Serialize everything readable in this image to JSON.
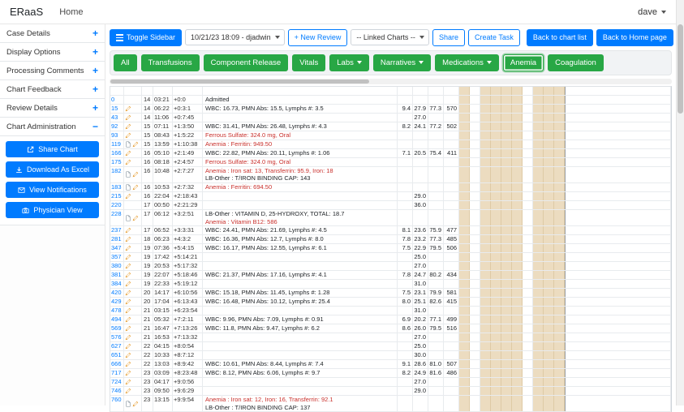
{
  "navbar": {
    "brand": "ERaaS",
    "home": "Home",
    "user": "dave"
  },
  "colors": {
    "primary": "#007bff",
    "success": "#28a745",
    "danger": "#c9302c",
    "highlight_cell": "#ecdcc0"
  },
  "sidebar": {
    "sections": [
      {
        "label": "Case Details",
        "toggle": "+",
        "expanded": false
      },
      {
        "label": "Display Options",
        "toggle": "+",
        "expanded": false
      },
      {
        "label": "Processing Comments",
        "toggle": "+",
        "expanded": false
      },
      {
        "label": "Chart Feedback",
        "toggle": "+",
        "expanded": false
      },
      {
        "label": "Review Details",
        "toggle": "+",
        "expanded": false
      },
      {
        "label": "Chart Administration",
        "toggle": "−",
        "expanded": true
      }
    ],
    "admin_buttons": [
      {
        "label": "Share Chart",
        "icon": "share-icon"
      },
      {
        "label": "Download As Excel",
        "icon": "download-icon"
      },
      {
        "label": "View Notifications",
        "icon": "mail-icon"
      },
      {
        "label": "Physician View",
        "icon": "camera-icon"
      }
    ]
  },
  "toolbar": {
    "toggle_sidebar": "Toggle Sidebar",
    "review_select": "10/21/23 18:09 - djadwin",
    "new_review": "+ New Review",
    "linked_charts": "-- Linked Charts --",
    "share": "Share",
    "create_task": "Create Task",
    "back_to_chart_list": "Back to chart list",
    "back_to_home": "Back to Home page"
  },
  "filters": [
    {
      "label": "All",
      "dropdown": false,
      "active": false
    },
    {
      "label": "Transfusions",
      "dropdown": false,
      "active": false
    },
    {
      "label": "Component Release",
      "dropdown": false,
      "active": false
    },
    {
      "label": "Vitals",
      "dropdown": false,
      "active": false
    },
    {
      "label": "Labs",
      "dropdown": true,
      "active": false
    },
    {
      "label": "Narratives",
      "dropdown": true,
      "active": false
    },
    {
      "label": "Medications",
      "dropdown": true,
      "active": false
    },
    {
      "label": "Anemia",
      "dropdown": false,
      "active": true
    },
    {
      "label": "Coagulation",
      "dropdown": false,
      "active": false
    }
  ],
  "table": {
    "stripes": [
      1,
      0,
      1,
      1,
      1,
      1,
      0,
      1,
      1,
      1
    ],
    "rows": [
      {
        "id": "0",
        "icons": [],
        "day": "14",
        "time": "03:21",
        "off": "+0:0",
        "lines": [
          {
            "t": "Admitted",
            "red": false
          }
        ],
        "vals": [
          "",
          "",
          "",
          ""
        ]
      },
      {
        "id": "15",
        "icons": [
          "pencil"
        ],
        "day": "14",
        "time": "06:22",
        "off": "+0:3:1",
        "lines": [
          {
            "t": "WBC: 16.73, PMN Abs: 15.5, Lymphs #: 3.5",
            "red": false
          }
        ],
        "vals": [
          "9.4",
          "27.9",
          "77.3",
          "570"
        ]
      },
      {
        "id": "43",
        "icons": [
          "pencil"
        ],
        "day": "14",
        "time": "11:06",
        "off": "+0:7:45",
        "lines": [],
        "vals": [
          "",
          "27.0",
          "",
          ""
        ]
      },
      {
        "id": "92",
        "icons": [
          "pencil"
        ],
        "day": "15",
        "time": "07:11",
        "off": "+1:3:50",
        "lines": [
          {
            "t": "WBC: 31.41, PMN Abs: 26.48, Lymphs #: 4.3",
            "red": false
          }
        ],
        "vals": [
          "8.2",
          "24.1",
          "77.2",
          "502"
        ]
      },
      {
        "id": "93",
        "icons": [
          "pencil"
        ],
        "day": "15",
        "time": "08:43",
        "off": "+1:5:22",
        "lines": [
          {
            "t": "Ferrous Sulfate: 324.0 mg, Oral",
            "red": true
          }
        ],
        "vals": [
          "",
          "",
          "",
          ""
        ]
      },
      {
        "id": "119",
        "icons": [
          "doc",
          "pencil"
        ],
        "day": "15",
        "time": "13:59",
        "off": "+1:10:38",
        "lines": [
          {
            "t": "Anemia : Ferritin: 949.50",
            "red": true
          }
        ],
        "vals": [
          "",
          "",
          "",
          ""
        ]
      },
      {
        "id": "166",
        "icons": [
          "pencil"
        ],
        "day": "16",
        "time": "05:10",
        "off": "+2:1:49",
        "lines": [
          {
            "t": "WBC: 22.82, PMN Abs: 20.11, Lymphs #: 1.06",
            "red": false
          }
        ],
        "vals": [
          "7.1",
          "20.5",
          "75.4",
          "411"
        ]
      },
      {
        "id": "175",
        "icons": [
          "pencil"
        ],
        "day": "16",
        "time": "08:18",
        "off": "+2:4:57",
        "lines": [
          {
            "t": "Ferrous Sulfate: 324.0 mg, Oral",
            "red": true
          }
        ],
        "vals": [
          "",
          "",
          "",
          ""
        ]
      },
      {
        "id": "182",
        "icons": [
          "doc",
          "pencil"
        ],
        "day": "16",
        "time": "10:48",
        "off": "+2:7:27",
        "lines": [
          {
            "t": "Anemia : Iron sat: 13, Transferrin: 95.9, Iron: 18",
            "red": true
          },
          {
            "t": "LB-Other : T/IRON BINDING CAP: 143",
            "red": false
          }
        ],
        "vals": [
          "",
          "",
          "",
          ""
        ]
      },
      {
        "id": "183",
        "icons": [
          "doc",
          "pencil"
        ],
        "day": "16",
        "time": "10:53",
        "off": "+2:7:32",
        "lines": [
          {
            "t": "Anemia : Ferritin: 694.50",
            "red": true
          }
        ],
        "vals": [
          "",
          "",
          "",
          ""
        ]
      },
      {
        "id": "215",
        "icons": [
          "pencil"
        ],
        "day": "16",
        "time": "22:04",
        "off": "+2:18:43",
        "lines": [],
        "vals": [
          "",
          "29.0",
          "",
          ""
        ]
      },
      {
        "id": "220",
        "icons": [],
        "day": "17",
        "time": "00:50",
        "off": "+2:21:29",
        "lines": [],
        "vals": [
          "",
          "36.0",
          "",
          ""
        ]
      },
      {
        "id": "228",
        "icons": [
          "doc",
          "pencil"
        ],
        "day": "17",
        "time": "06:12",
        "off": "+3:2:51",
        "lines": [
          {
            "t": "LB-Other : VITAMIN D, 25-HYDROXY, TOTAL: 18.7",
            "red": false
          },
          {
            "t": "Anemia : Vitamin B12: 586",
            "red": true
          }
        ],
        "vals": [
          "",
          "",
          "",
          ""
        ]
      },
      {
        "id": "237",
        "icons": [
          "pencil"
        ],
        "day": "17",
        "time": "06:52",
        "off": "+3:3:31",
        "lines": [
          {
            "t": "WBC: 24.41, PMN Abs: 21.69, Lymphs #: 4.5",
            "red": false
          }
        ],
        "vals": [
          "8.1",
          "23.6",
          "75.9",
          "477"
        ]
      },
      {
        "id": "281",
        "icons": [
          "pencil"
        ],
        "day": "18",
        "time": "06:23",
        "off": "+4:3:2",
        "lines": [
          {
            "t": "WBC: 16.36, PMN Abs: 12.7, Lymphs #: 8.0",
            "red": false
          }
        ],
        "vals": [
          "7.8",
          "23.2",
          "77.3",
          "485"
        ]
      },
      {
        "id": "347",
        "icons": [
          "pencil"
        ],
        "day": "19",
        "time": "07:36",
        "off": "+5:4:15",
        "lines": [
          {
            "t": "WBC: 16.17, PMN Abs: 12.55, Lymphs #: 6.1",
            "red": false
          }
        ],
        "vals": [
          "7.5",
          "22.9",
          "79.5",
          "506"
        ]
      },
      {
        "id": "357",
        "icons": [
          "pencil"
        ],
        "day": "19",
        "time": "17:42",
        "off": "+5:14:21",
        "lines": [],
        "vals": [
          "",
          "25.0",
          "",
          ""
        ]
      },
      {
        "id": "380",
        "icons": [
          "pencil"
        ],
        "day": "19",
        "time": "20:53",
        "off": "+5:17:32",
        "lines": [],
        "vals": [
          "",
          "27.0",
          "",
          ""
        ]
      },
      {
        "id": "381",
        "icons": [
          "pencil"
        ],
        "day": "19",
        "time": "22:07",
        "off": "+5:18:46",
        "lines": [
          {
            "t": "WBC: 21.37, PMN Abs: 17.16, Lymphs #: 4.1",
            "red": false
          }
        ],
        "vals": [
          "7.8",
          "24.7",
          "80.2",
          "434"
        ]
      },
      {
        "id": "384",
        "icons": [
          "pencil"
        ],
        "day": "19",
        "time": "22:33",
        "off": "+5:19:12",
        "lines": [],
        "vals": [
          "",
          "31.0",
          "",
          ""
        ]
      },
      {
        "id": "420",
        "icons": [
          "pencil"
        ],
        "day": "20",
        "time": "14:17",
        "off": "+6:10:56",
        "lines": [
          {
            "t": "WBC: 15.18, PMN Abs: 11.45, Lymphs #: 1.28",
            "red": false
          }
        ],
        "vals": [
          "7.5",
          "23.1",
          "79.9",
          "581"
        ]
      },
      {
        "id": "429",
        "icons": [
          "pencil"
        ],
        "day": "20",
        "time": "17:04",
        "off": "+6:13:43",
        "lines": [
          {
            "t": "WBC: 16.48, PMN Abs: 10.12, Lymphs #: 25.4",
            "red": false
          }
        ],
        "vals": [
          "8.0",
          "25.1",
          "82.6",
          "415"
        ]
      },
      {
        "id": "478",
        "icons": [
          "pencil"
        ],
        "day": "21",
        "time": "03:15",
        "off": "+6:23:54",
        "lines": [],
        "vals": [
          "",
          "31.0",
          "",
          ""
        ]
      },
      {
        "id": "494",
        "icons": [
          "pencil"
        ],
        "day": "21",
        "time": "05:32",
        "off": "+7:2:11",
        "lines": [
          {
            "t": "WBC: 9.96, PMN Abs: 7.09, Lymphs #: 0.91",
            "red": false
          }
        ],
        "vals": [
          "6.9",
          "20.2",
          "77.1",
          "499"
        ]
      },
      {
        "id": "569",
        "icons": [
          "pencil"
        ],
        "day": "21",
        "time": "16:47",
        "off": "+7:13:26",
        "lines": [
          {
            "t": "WBC: 11.8, PMN Abs: 9.47, Lymphs #: 6.2",
            "red": false
          }
        ],
        "vals": [
          "8.6",
          "26.0",
          "79.5",
          "516"
        ]
      },
      {
        "id": "576",
        "icons": [
          "pencil"
        ],
        "day": "21",
        "time": "16:53",
        "off": "+7:13:32",
        "lines": [],
        "vals": [
          "",
          "27.0",
          "",
          ""
        ]
      },
      {
        "id": "627",
        "icons": [
          "pencil"
        ],
        "day": "22",
        "time": "04:15",
        "off": "+8:0:54",
        "lines": [],
        "vals": [
          "",
          "25.0",
          "",
          ""
        ]
      },
      {
        "id": "651",
        "icons": [
          "pencil"
        ],
        "day": "22",
        "time": "10:33",
        "off": "+8:7:12",
        "lines": [],
        "vals": [
          "",
          "30.0",
          "",
          ""
        ]
      },
      {
        "id": "666",
        "icons": [
          "pencil"
        ],
        "day": "22",
        "time": "13:03",
        "off": "+8:9:42",
        "lines": [
          {
            "t": "WBC: 10.61, PMN Abs: 8.44, Lymphs #: 7.4",
            "red": false
          }
        ],
        "vals": [
          "9.1",
          "28.6",
          "81.0",
          "507"
        ]
      },
      {
        "id": "717",
        "icons": [
          "pencil"
        ],
        "day": "23",
        "time": "03:09",
        "off": "+8:23:48",
        "lines": [
          {
            "t": "WBC: 8.12, PMN Abs: 6.06, Lymphs #: 9.7",
            "red": false
          }
        ],
        "vals": [
          "8.2",
          "24.9",
          "81.6",
          "486"
        ]
      },
      {
        "id": "724",
        "icons": [
          "pencil"
        ],
        "day": "23",
        "time": "04:17",
        "off": "+9:0:56",
        "lines": [],
        "vals": [
          "",
          "27.0",
          "",
          ""
        ]
      },
      {
        "id": "746",
        "icons": [
          "pencil"
        ],
        "day": "23",
        "time": "09:50",
        "off": "+9:6:29",
        "lines": [],
        "vals": [
          "",
          "29.0",
          "",
          ""
        ]
      },
      {
        "id": "760",
        "icons": [
          "doc",
          "pencil"
        ],
        "day": "23",
        "time": "13:15",
        "off": "+9:9:54",
        "lines": [
          {
            "t": "Anemia : Iron sat: 12, Iron: 16, Transferrin: 92.1",
            "red": true
          },
          {
            "t": "LB-Other : T/IRON BINDING CAP: 137",
            "red": false
          }
        ],
        "vals": [
          "",
          "",
          "",
          ""
        ]
      }
    ]
  }
}
